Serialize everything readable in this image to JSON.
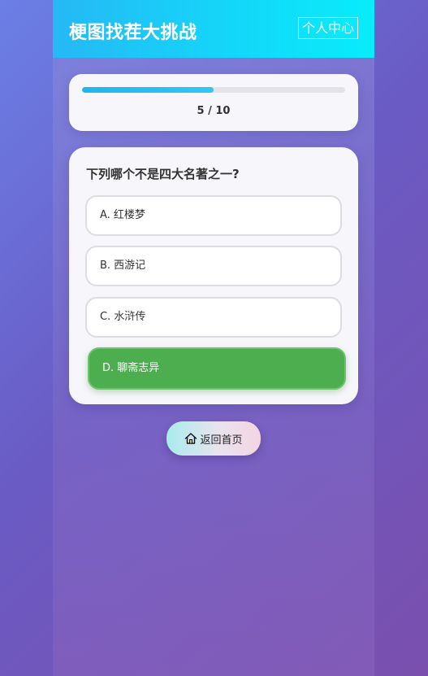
{
  "header": {
    "title": "梗图找茬大挑战",
    "profile_label": "个人中心"
  },
  "progress": {
    "current": 5,
    "total": 10,
    "text": "5 / 10"
  },
  "question": {
    "text": "下列哪个不是四大名著之一?",
    "options": [
      {
        "label": "A. 红楼梦",
        "selected": false
      },
      {
        "label": "B. 西游记",
        "selected": false
      },
      {
        "label": "C. 水浒传",
        "selected": false
      },
      {
        "label": "D. 聊斋志异",
        "selected": true
      }
    ]
  },
  "footer": {
    "home_label": "返回首页",
    "home_icon": "home-icon"
  },
  "colors": {
    "header_start": "#26b8f5",
    "header_end": "#08ecfb",
    "progress_fill": "#1fb6ee",
    "selected_option": "#4cae4f",
    "background": "#6a5bc4"
  }
}
